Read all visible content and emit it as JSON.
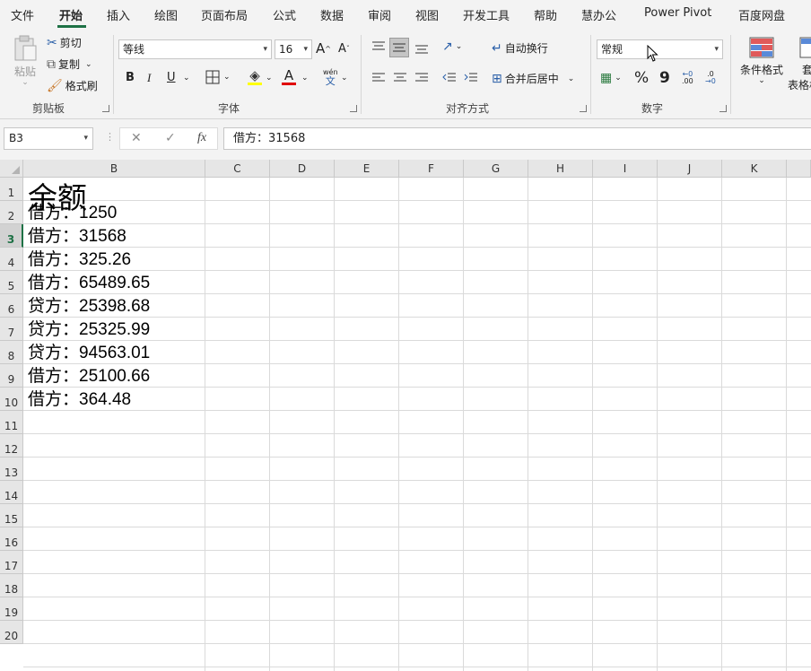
{
  "menu": {
    "tabs": [
      "文件",
      "开始",
      "插入",
      "绘图",
      "页面布局",
      "公式",
      "数据",
      "审阅",
      "视图",
      "开发工具",
      "帮助",
      "慧办公",
      "Power Pivot",
      "百度网盘"
    ],
    "active": "开始"
  },
  "ribbon": {
    "clipboard": {
      "label": "剪贴板",
      "paste": "粘贴",
      "cut": "剪切",
      "copy": "复制",
      "format_painter": "格式刷"
    },
    "font": {
      "label": "字体",
      "font_name": "等线",
      "font_size": "16",
      "increase_size": "A",
      "decrease_size": "A",
      "bold": "B",
      "italic": "I",
      "underline": "U",
      "phonetic": "wén",
      "phonetic_sub": "文",
      "font_color_letter": "A"
    },
    "alignment": {
      "label": "对齐方式",
      "wrap_text": "自动换行",
      "merge_center": "合并后居中"
    },
    "number": {
      "label": "数字",
      "format": "常规",
      "percent": "%",
      "comma": "9",
      "inc_decimal": ".00",
      "dec_decimal": ".0"
    },
    "styles": {
      "conditional_format": "条件格式",
      "table_format_a": "套",
      "table_format_b": "表格格"
    }
  },
  "formula_bar": {
    "name_box": "B3",
    "cancel": "✕",
    "enter": "✓",
    "fx": "fx",
    "content": "借方：31568"
  },
  "sheet": {
    "columns": [
      "B",
      "C",
      "D",
      "E",
      "F",
      "G",
      "H",
      "I",
      "J",
      "K"
    ],
    "rows": [
      "1",
      "2",
      "3",
      "4",
      "5",
      "6",
      "7",
      "8",
      "9",
      "10",
      "11",
      "12",
      "13",
      "14",
      "15",
      "16",
      "17",
      "18",
      "19",
      "20"
    ],
    "selected_row": "3",
    "title": "余额",
    "values": [
      "借方：1250",
      "借方：31568",
      "借方：325.26",
      "借方：65489.65",
      "贷方：25398.68",
      "贷方：25325.99",
      "贷方：94563.01",
      "借方：25100.66",
      "借方：364.48"
    ]
  },
  "colors": {
    "accent": "#1e7145",
    "ribbon_bg": "#f3f3f3",
    "header_bg": "#e6e6e6",
    "gridline": "#dadada",
    "font_color_bar": "#e00000",
    "highlight_bar": "#ffff00"
  }
}
